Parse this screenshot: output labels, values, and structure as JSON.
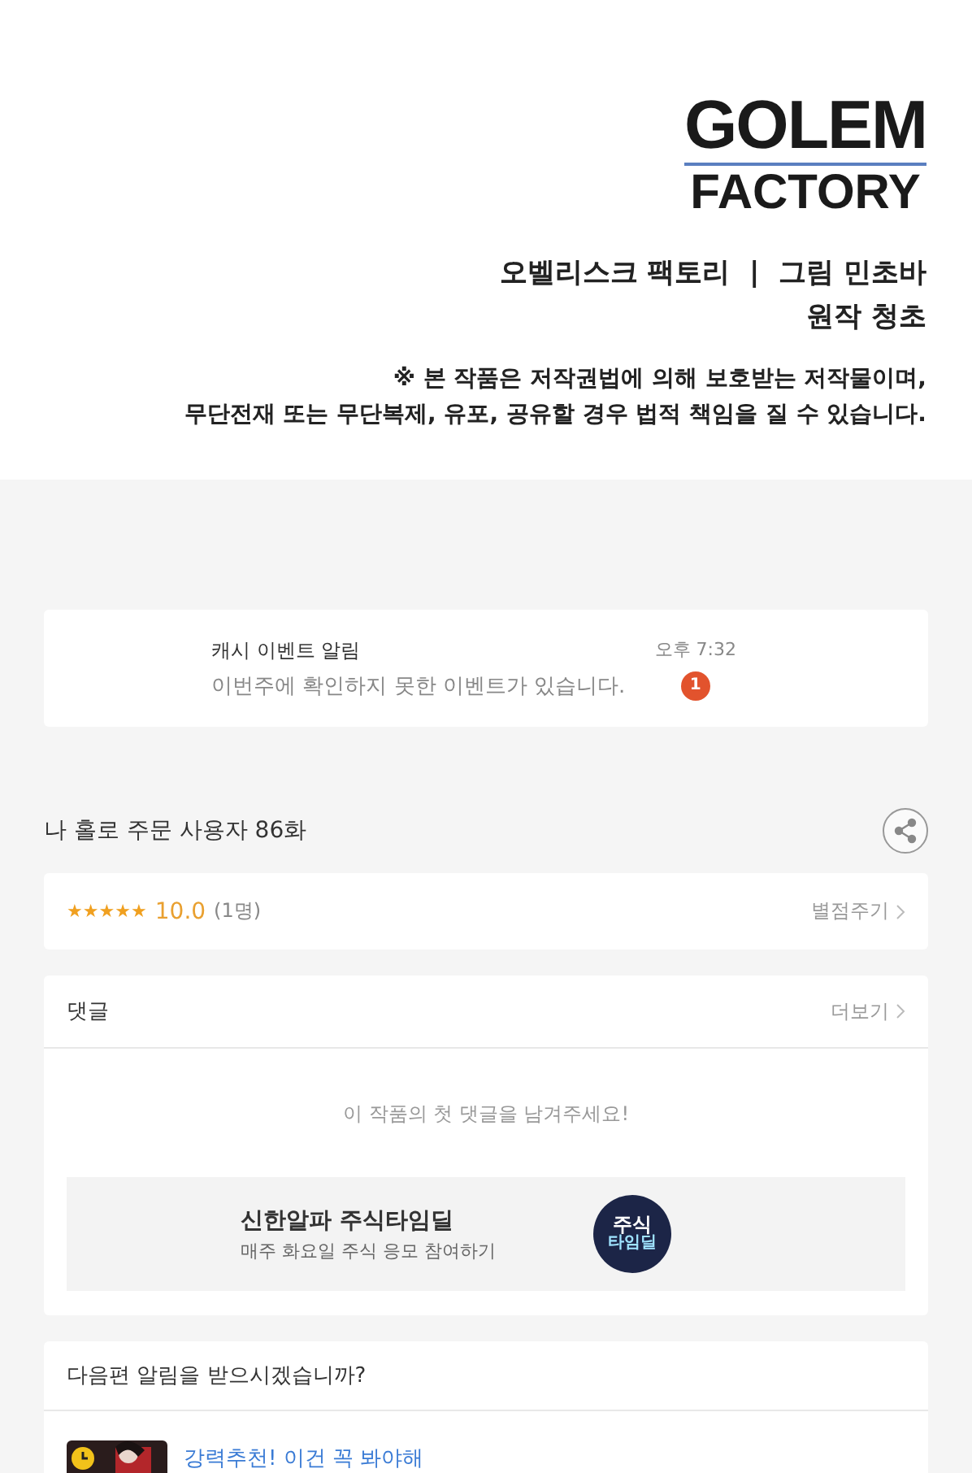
{
  "header": {
    "logo_line_1": "GOLEM",
    "logo_line_2": "FACTORY",
    "credits": [
      "오벨리스크 팩토리  |  그림 민초바",
      "원작 청초"
    ],
    "notice": [
      "※ 본 작품은 저작권법에 의해 보호받는 저작물이며,",
      "무단전재 또는 무단복제, 유포, 공유할 경우 법적 책임을 질 수 있습니다."
    ]
  },
  "notification": {
    "title": "캐시 이벤트 알림",
    "message": "이번주에 확인하지 못한 이벤트가 있습니다.",
    "time": "오후 7:32",
    "badge": "1"
  },
  "episode": {
    "title": "나 홀로 주문 사용자 86화"
  },
  "rating": {
    "stars": 5,
    "score": "10.0",
    "count": "(1명)",
    "action": "별점주기"
  },
  "comments": {
    "title": "댓글",
    "more": "더보기",
    "empty": "이 작품의 첫 댓글을 남겨주세요!"
  },
  "ad": {
    "title": "신한알파 주식타임딜",
    "subtitle": "매주 화요일 주식 응모 참여하기",
    "badge_line_1": "주식",
    "badge_line_2": "타임딜"
  },
  "next": {
    "question": "다음편 알림을 받으시겠습니까?",
    "recommendation": "강력추천! 이건 꼭 봐야해"
  }
}
